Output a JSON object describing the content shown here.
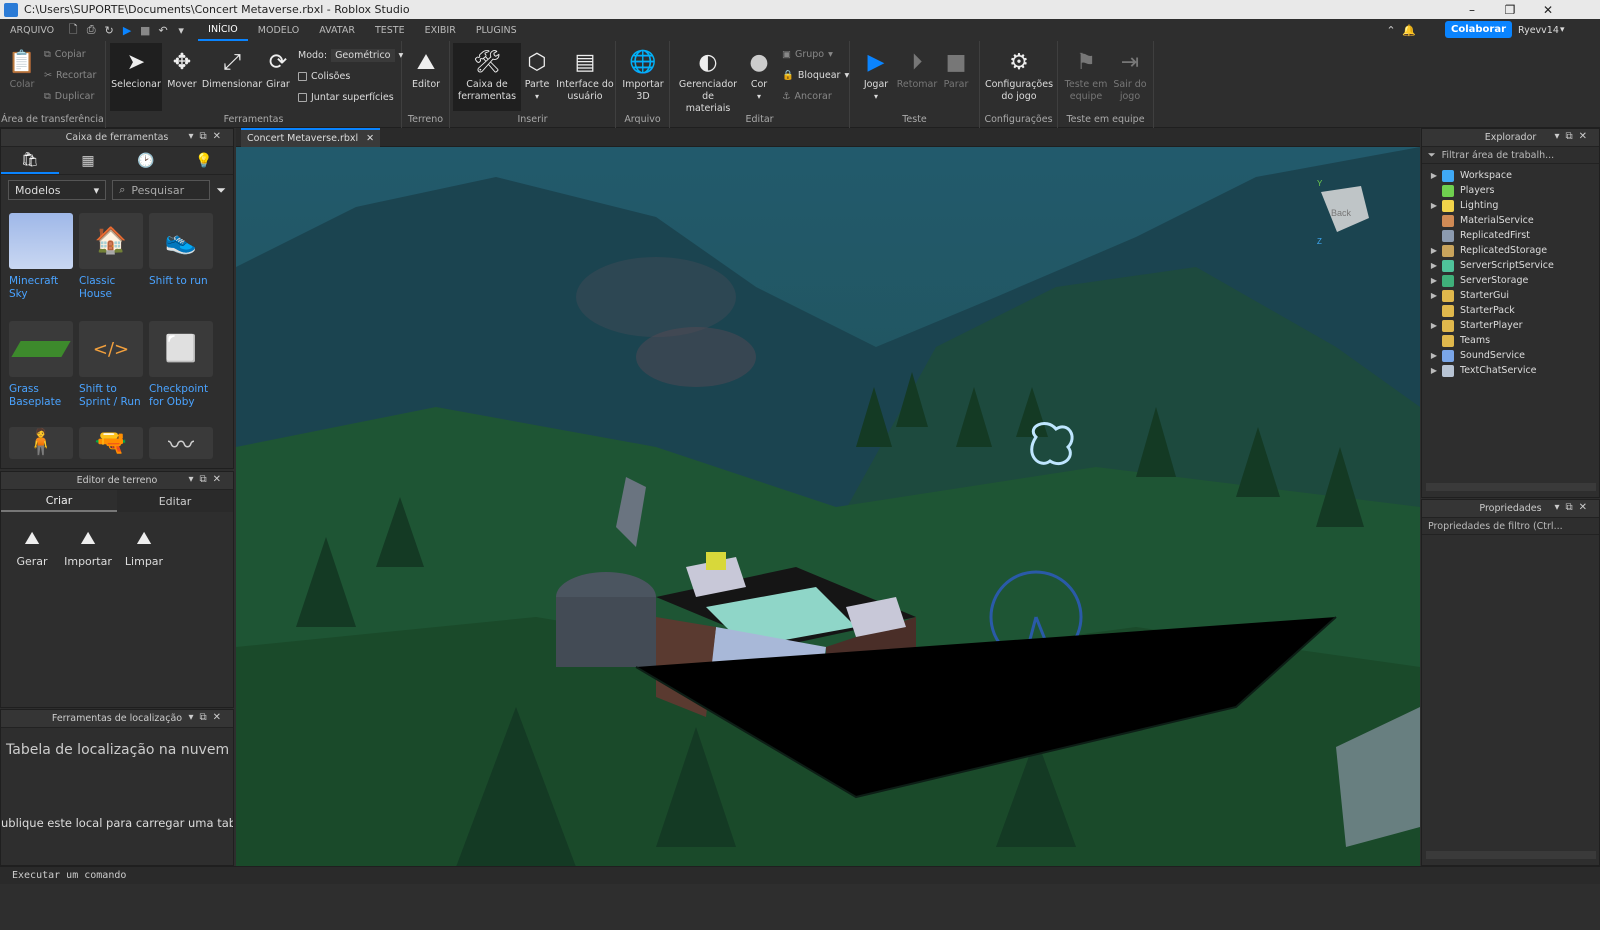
{
  "window": {
    "title": "C:\\Users\\SUPORTE\\Documents\\Concert Metaverse.rbxl - Roblox Studio"
  },
  "menubar": {
    "file": "ARQUIVO",
    "tabs": [
      "INÍCIO",
      "MODELO",
      "AVATAR",
      "TESTE",
      "EXIBIR",
      "PLUGINS"
    ],
    "active_tab": "INÍCIO",
    "collab_label": "Colaborar",
    "username": "Ryevv14"
  },
  "ribbon": {
    "clipboard": {
      "paste": "Colar",
      "copy": "Copiar",
      "cut": "Recortar",
      "duplicate": "Duplicar",
      "group_label": "Área de transferência"
    },
    "tools": {
      "select": "Selecionar",
      "move": "Mover",
      "scale": "Dimensionar",
      "rotate": "Girar",
      "mode_label": "Modo:",
      "mode_value": "Geométrico",
      "collisions": "Colisões",
      "join_surfaces": "Juntar superfícies",
      "group_label": "Ferramentas"
    },
    "terrain": {
      "editor": "Editor",
      "group_label": "Terreno"
    },
    "insert": {
      "toolbox_line1": "Caixa de",
      "toolbox_line2": "ferramentas",
      "part": "Parte",
      "ui_line1": "Interface do",
      "ui_line2": "usuário",
      "group_label": "Inserir"
    },
    "file": {
      "import_line1": "Importar",
      "import_line2": "3D",
      "group_label": "Arquivo"
    },
    "edit": {
      "materials_line1": "Gerenciador de",
      "materials_line2": "materiais",
      "color": "Cor",
      "group": "Grupo",
      "lock": "Bloquear",
      "anchor": "Ancorar",
      "group_label": "Editar"
    },
    "test": {
      "play": "Jogar",
      "resume": "Retomar",
      "stop": "Parar",
      "group_label": "Teste"
    },
    "settings": {
      "game_settings_line1": "Configurações",
      "game_settings_line2": "do jogo",
      "group_label": "Configurações"
    },
    "team_test": {
      "team_test_line1": "Teste em",
      "team_test_line2": "equipe",
      "exit_line1": "Sair do",
      "exit_line2": "jogo",
      "group_label": "Teste em equipe"
    }
  },
  "toolbox": {
    "title": "Caixa de ferramentas",
    "category": "Modelos",
    "search_placeholder": "Pesquisar",
    "items": [
      {
        "line1": "Minecraft",
        "line2": "Sky"
      },
      {
        "line1": "Classic",
        "line2": "House"
      },
      {
        "line1": "Shift to run",
        "line2": ""
      },
      {
        "line1": "Grass",
        "line2": "Baseplate"
      },
      {
        "line1": "Shift to",
        "line2": "Sprint / Run"
      },
      {
        "line1": "Checkpoint",
        "line2": "for Obby"
      }
    ]
  },
  "terrain_editor": {
    "title": "Editor de terreno",
    "tabs": [
      "Criar",
      "Editar"
    ],
    "buttons": [
      "Gerar",
      "Importar",
      "Limpar"
    ]
  },
  "localization": {
    "title": "Ferramentas de localização",
    "heading": "Tabela de localização na nuvem",
    "message": "ublique este local para carregar uma tabel"
  },
  "document": {
    "tab": "Concert Metaverse.rbxl"
  },
  "viewcube": {
    "label": "Back",
    "y_axis": "Y",
    "z_axis": "Z"
  },
  "explorer": {
    "title": "Explorador",
    "filter_placeholder": "Filtrar área de trabalh...",
    "items": [
      {
        "name": "Workspace",
        "expandable": true,
        "color": "#3fa9f5"
      },
      {
        "name": "Players",
        "expandable": false,
        "color": "#6fcf4f"
      },
      {
        "name": "Lighting",
        "expandable": true,
        "color": "#f2d34a"
      },
      {
        "name": "MaterialService",
        "expandable": false,
        "color": "#d08a55"
      },
      {
        "name": "ReplicatedFirst",
        "expandable": false,
        "color": "#8c9bb0"
      },
      {
        "name": "ReplicatedStorage",
        "expandable": true,
        "color": "#c9a45c"
      },
      {
        "name": "ServerScriptService",
        "expandable": true,
        "color": "#4fc29a"
      },
      {
        "name": "ServerStorage",
        "expandable": true,
        "color": "#3fb07a"
      },
      {
        "name": "StarterGui",
        "expandable": true,
        "color": "#e0b84c"
      },
      {
        "name": "StarterPack",
        "expandable": false,
        "color": "#e0b84c"
      },
      {
        "name": "StarterPlayer",
        "expandable": true,
        "color": "#e0b84c"
      },
      {
        "name": "Teams",
        "expandable": false,
        "color": "#e0b84c"
      },
      {
        "name": "SoundService",
        "expandable": true,
        "color": "#7aa6e8"
      },
      {
        "name": "TextChatService",
        "expandable": true,
        "color": "#b8c4d4"
      }
    ]
  },
  "properties": {
    "title": "Propriedades",
    "filter_placeholder": "Propriedades de filtro (Ctrl..."
  },
  "command_bar": {
    "placeholder": "Executar um comando"
  },
  "colors": {
    "accent": "#0a84ff",
    "link": "#4aa3ff",
    "panel_bg": "#2e2e2e"
  }
}
